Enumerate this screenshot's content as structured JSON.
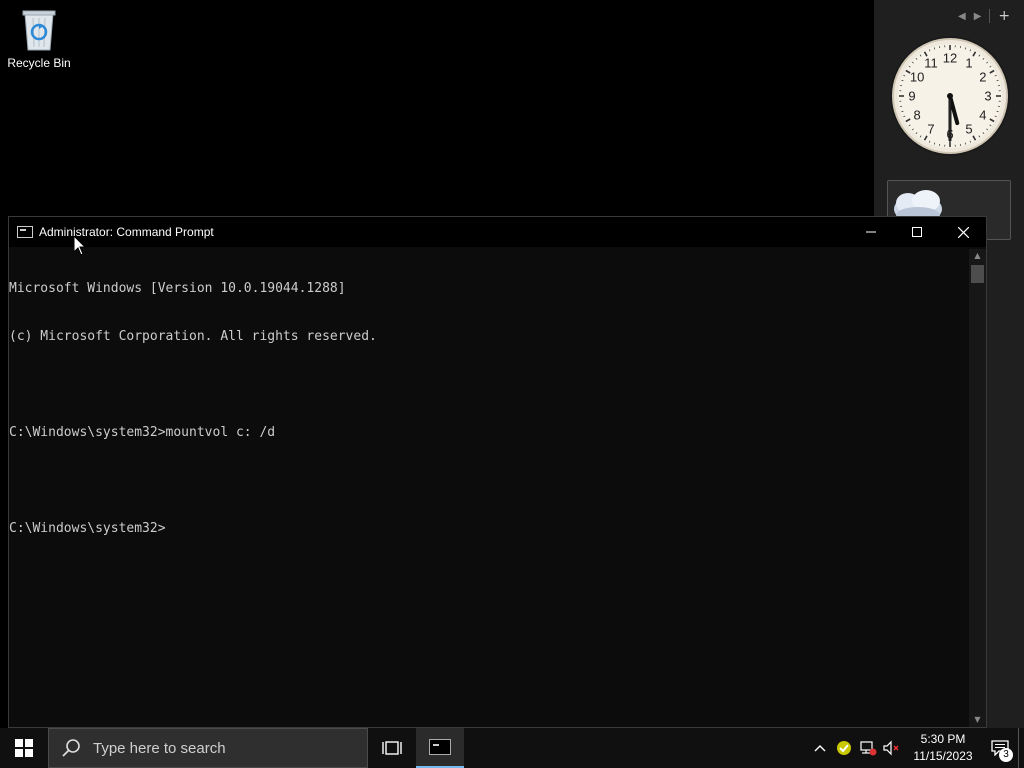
{
  "desktop": {
    "recycle_bin_label": "Recycle Bin"
  },
  "sidebar": {
    "clock": {
      "hour": 5,
      "minute": 30,
      "second": 30
    },
    "numerals": [
      "12",
      "1",
      "2",
      "3",
      "4",
      "5",
      "6",
      "7",
      "8",
      "9",
      "10",
      "11"
    ]
  },
  "window": {
    "title": "Administrator: Command Prompt",
    "lines": [
      "Microsoft Windows [Version 10.0.19044.1288]",
      "(c) Microsoft Corporation. All rights reserved.",
      "",
      "C:\\Windows\\system32>mountvol c: /d",
      "",
      "C:\\Windows\\system32>"
    ]
  },
  "taskbar": {
    "search_placeholder": "Type here to search",
    "time": "5:30 PM",
    "date": "11/15/2023",
    "notification_count": "3"
  },
  "colors": {
    "console_bg": "#0c0c0c",
    "console_text": "#cccccc",
    "taskbar_bg": "#101010",
    "accent": "#76b9ed"
  }
}
